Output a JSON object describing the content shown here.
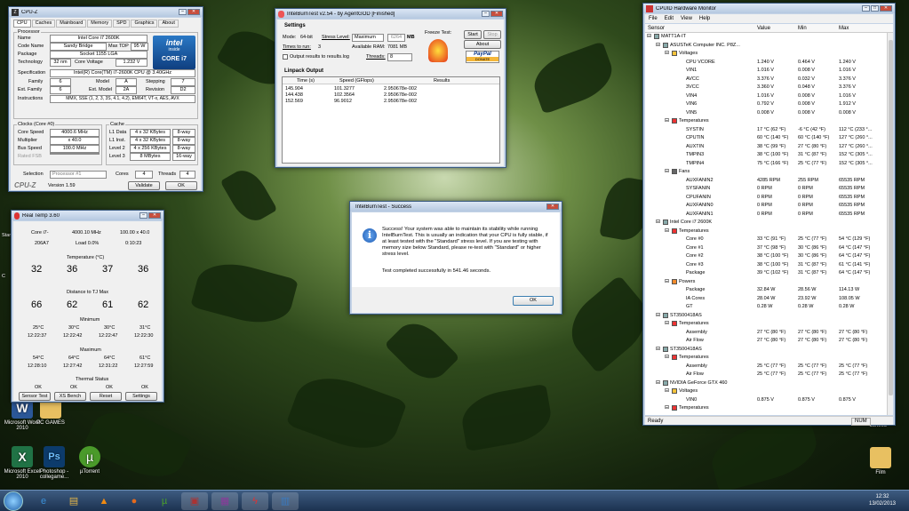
{
  "cpuz": {
    "title": "CPU-Z",
    "tabs": [
      "CPU",
      "Caches",
      "Mainboard",
      "Memory",
      "SPD",
      "Graphics",
      "About"
    ],
    "processor_group": "Processor",
    "name_label": "Name",
    "name": "Intel Core i7 2600K",
    "codename_label": "Code Name",
    "codename": "Sandy Bridge",
    "maxtdp_label": "Max TDP",
    "maxtdp": "95 W",
    "package_label": "Package",
    "package": "Socket 1155 LGA",
    "tech_label": "Technology",
    "tech": "32 nm",
    "voltage_label": "Core Voltage",
    "voltage": "1.232 V",
    "spec_label": "Specification",
    "spec": "Intel(R) Core(TM) i7-2600K CPU @ 3.40GHz",
    "family_label": "Family",
    "family": "6",
    "model_label": "Model",
    "model": "A",
    "stepping_label": "Stepping",
    "stepping": "7",
    "extfamily_label": "Ext. Family",
    "extfamily": "6",
    "extmodel_label": "Ext. Model",
    "extmodel": "2A",
    "revision_label": "Revision",
    "revision": "D2",
    "instr_label": "Instructions",
    "instr": "MMX, SSE (1, 2, 3, 3S, 4.1, 4.2), EM64T, VT-x, AES, AVX",
    "clocks_group": "Clocks (Core #0)",
    "corespeed_label": "Core Speed",
    "corespeed": "4000.6 MHz",
    "mult_label": "Multiplier",
    "mult": "x 40.0",
    "bus_label": "Bus Speed",
    "bus": "100.0 MHz",
    "fsb_label": "Rated FSB",
    "fsb": "",
    "cache_group": "Cache",
    "l1d_label": "L1 Data",
    "l1d": "4 x 32 KBytes",
    "l1d_way": "8-way",
    "l1i_label": "L1 Inst.",
    "l1i": "4 x 32 KBytes",
    "l1i_way": "8-way",
    "l2_label": "Level 2",
    "l2": "4 x 256 KBytes",
    "l2_way": "8-way",
    "l3_label": "Level 3",
    "l3": "8 MBytes",
    "l3_way": "16-way",
    "selection_label": "Selection",
    "selection": "Processor #1",
    "cores_label": "Cores",
    "cores": "4",
    "threads_label": "Threads",
    "threads": "4",
    "brand": "CPU-Z",
    "version": "Version 1.59",
    "validate": "Validate",
    "ok": "OK",
    "logo_top": "intel",
    "logo_mid": "inside",
    "logo_bottom": "CORE i7"
  },
  "realtemp": {
    "title": "Real Temp 3.60",
    "cpu": "Core i7-",
    "mhz": "4000.10 MHz",
    "mult": "100.00 x 40.0",
    "cpuid": "206A7",
    "load": "Load  0.0%",
    "uptime": "0:10:23",
    "temp_header": "Temperature (°C)",
    "temps": [
      "32",
      "36",
      "37",
      "36"
    ],
    "dist_header": "Distance to TJ Max",
    "dists": [
      "66",
      "62",
      "61",
      "62"
    ],
    "min_header": "Minimum",
    "mins": [
      "25°C",
      "30°C",
      "30°C",
      "31°C"
    ],
    "min_times": [
      "12:22:37",
      "12:22:42",
      "12:22:47",
      "12:22:30"
    ],
    "max_header": "Maximum",
    "maxs": [
      "54°C",
      "64°C",
      "64°C",
      "61°C"
    ],
    "max_times": [
      "12:28:10",
      "12:27:42",
      "12:31:22",
      "12:27:59"
    ],
    "thermal_header": "Thermal Status",
    "thermal": [
      "OK",
      "OK",
      "OK",
      "OK"
    ],
    "buttons": [
      "Sensor Test",
      "XS Bench",
      "Reset",
      "Settings"
    ]
  },
  "ibt": {
    "title": "IntelBurnTest v2.54 - by AgentGOD [Finished]",
    "settings": "Settings",
    "mode_label": "Mode:",
    "mode": "64-bit",
    "stress_label": "Stress Level:",
    "stress": "Maximum",
    "stress_mb": "6264",
    "mb": "MB",
    "times_label": "Times to run:",
    "times": "3",
    "ram_label": "Available RAM:",
    "ram": "7081 MB",
    "output_label": "Output results to results.log",
    "threads_label": "Threads:",
    "threads": "8",
    "freeze": "Freeze Test:",
    "start": "Start",
    "stop": "Stop",
    "about": "About",
    "paypal": "PayPal",
    "donate": "DONATE",
    "linpack": "Linpack Output",
    "cols": [
      "Time (s)",
      "Speed (GFlops)",
      "Results"
    ],
    "rows": [
      [
        "145.904",
        "101.3277",
        "2.950678e-002"
      ],
      [
        "144.438",
        "102.3564",
        "2.950678e-002"
      ],
      [
        "152.569",
        "96.9012",
        "2.950678e-002"
      ]
    ]
  },
  "dialog": {
    "title": "IntelBurnTest - Success",
    "msg": "Success! Your system was able to maintain its stability while running IntelBurnTest. This is usually an indication that your CPU is fully stable, if at least tested with the \"Standard\" stress level. If you are testing with memory size below Standard, please re-test with \"Standard\" or higher stress level.",
    "msg2": "Test completed successfully in 541.46 seconds.",
    "ok": "OK"
  },
  "hwmon": {
    "title": "CPUID Hardware Monitor",
    "menu": [
      "File",
      "Edit",
      "View",
      "Help"
    ],
    "cols": [
      "Sensor",
      "Value",
      "Min",
      "Max"
    ],
    "rows": [
      {
        "lvl": 0,
        "kind": "node",
        "name": "MATT1A-IT",
        "value": "",
        "min": "",
        "max": ""
      },
      {
        "lvl": 1,
        "kind": "node",
        "name": "ASUSTeK Computer INC. P8Z...",
        "value": "",
        "min": "",
        "max": ""
      },
      {
        "lvl": 2,
        "kind": "group",
        "name": "Voltages",
        "value": "",
        "min": "",
        "max": ""
      },
      {
        "lvl": 3,
        "kind": "item",
        "name": "CPU VCORE",
        "value": "1.240 V",
        "min": "0.464 V",
        "max": "1.240 V"
      },
      {
        "lvl": 3,
        "kind": "item",
        "name": "VIN1",
        "value": "1.016 V",
        "min": "0.008 V",
        "max": "1.016 V"
      },
      {
        "lvl": 3,
        "kind": "item",
        "name": "AVCC",
        "value": "3.376 V",
        "min": "0.032 V",
        "max": "3.376 V"
      },
      {
        "lvl": 3,
        "kind": "item",
        "name": "3VCC",
        "value": "3.360 V",
        "min": "0.048 V",
        "max": "3.376 V"
      },
      {
        "lvl": 3,
        "kind": "item",
        "name": "VIN4",
        "value": "1.016 V",
        "min": "0.008 V",
        "max": "1.016 V"
      },
      {
        "lvl": 3,
        "kind": "item",
        "name": "VIN6",
        "value": "0.792 V",
        "min": "0.008 V",
        "max": "1.912 V"
      },
      {
        "lvl": 3,
        "kind": "item",
        "name": "VIN5",
        "value": "0.008 V",
        "min": "0.008 V",
        "max": "0.008 V"
      },
      {
        "lvl": 2,
        "kind": "group",
        "name": "Temperatures",
        "value": "",
        "min": "",
        "max": ""
      },
      {
        "lvl": 3,
        "kind": "item",
        "name": "SYSTIN",
        "value": "17 °C (62 °F)",
        "min": "-6 °C (42 °F)",
        "max": "112 °C (233 °..."
      },
      {
        "lvl": 3,
        "kind": "item",
        "name": "CPUTIN",
        "value": "60 °C (140 °F)",
        "min": "60 °C (140 °F)",
        "max": "127 °C (260 °..."
      },
      {
        "lvl": 3,
        "kind": "item",
        "name": "AUXTIN",
        "value": "38 °C (99 °F)",
        "min": "27 °C (80 °F)",
        "max": "127 °C (260 °..."
      },
      {
        "lvl": 3,
        "kind": "item",
        "name": "TMPIN3",
        "value": "38 °C (100 °F)",
        "min": "31 °C (87 °F)",
        "max": "152 °C (305 °..."
      },
      {
        "lvl": 3,
        "kind": "item",
        "name": "TMPIN4",
        "value": "75 °C (166 °F)",
        "min": "25 °C (77 °F)",
        "max": "152 °C (305 °..."
      },
      {
        "lvl": 2,
        "kind": "group",
        "name": "Fans",
        "value": "",
        "min": "",
        "max": ""
      },
      {
        "lvl": 3,
        "kind": "item",
        "name": "AUXFANIN2",
        "value": "4285 RPM",
        "min": "255 RPM",
        "max": "65535 RPM"
      },
      {
        "lvl": 3,
        "kind": "item",
        "name": "SYSFANIN",
        "value": "0 RPM",
        "min": "0 RPM",
        "max": "65535 RPM"
      },
      {
        "lvl": 3,
        "kind": "item",
        "name": "CPUFANIN",
        "value": "0 RPM",
        "min": "0 RPM",
        "max": "65535 RPM"
      },
      {
        "lvl": 3,
        "kind": "item",
        "name": "AUXFANIN0",
        "value": "0 RPM",
        "min": "0 RPM",
        "max": "65535 RPM"
      },
      {
        "lvl": 3,
        "kind": "item",
        "name": "AUXFANIN1",
        "value": "0 RPM",
        "min": "0 RPM",
        "max": "65535 RPM"
      },
      {
        "lvl": 1,
        "kind": "node",
        "name": "Intel Core i7 2600K",
        "value": "",
        "min": "",
        "max": ""
      },
      {
        "lvl": 2,
        "kind": "group",
        "name": "Temperatures",
        "value": "",
        "min": "",
        "max": ""
      },
      {
        "lvl": 3,
        "kind": "item",
        "name": "Core #0",
        "value": "33 °C (91 °F)",
        "min": "25 °C (77 °F)",
        "max": "54 °C (129 °F)"
      },
      {
        "lvl": 3,
        "kind": "item",
        "name": "Core #1",
        "value": "37 °C (98 °F)",
        "min": "30 °C (86 °F)",
        "max": "64 °C (147 °F)"
      },
      {
        "lvl": 3,
        "kind": "item",
        "name": "Core #2",
        "value": "38 °C (100 °F)",
        "min": "30 °C (86 °F)",
        "max": "64 °C (147 °F)"
      },
      {
        "lvl": 3,
        "kind": "item",
        "name": "Core #3",
        "value": "38 °C (100 °F)",
        "min": "31 °C (87 °F)",
        "max": "61 °C (141 °F)"
      },
      {
        "lvl": 3,
        "kind": "item",
        "name": "Package",
        "value": "39 °C (102 °F)",
        "min": "31 °C (87 °F)",
        "max": "64 °C (147 °F)"
      },
      {
        "lvl": 2,
        "kind": "group",
        "name": "Powers",
        "value": "",
        "min": "",
        "max": ""
      },
      {
        "lvl": 3,
        "kind": "item",
        "name": "Package",
        "value": "32.84 W",
        "min": "28.56 W",
        "max": "114.13 W"
      },
      {
        "lvl": 3,
        "kind": "item",
        "name": "IA Cores",
        "value": "28.04 W",
        "min": "23.92 W",
        "max": "108.05 W"
      },
      {
        "lvl": 3,
        "kind": "item",
        "name": "GT",
        "value": "0.28 W",
        "min": "0.28 W",
        "max": "0.28 W"
      },
      {
        "lvl": 1,
        "kind": "node",
        "name": "ST3500418AS",
        "value": "",
        "min": "",
        "max": ""
      },
      {
        "lvl": 2,
        "kind": "group",
        "name": "Temperatures",
        "value": "",
        "min": "",
        "max": ""
      },
      {
        "lvl": 3,
        "kind": "item",
        "name": "Assembly",
        "value": "27 °C (80 °F)",
        "min": "27 °C (80 °F)",
        "max": "27 °C (80 °F)"
      },
      {
        "lvl": 3,
        "kind": "item",
        "name": "Air Flow",
        "value": "27 °C (80 °F)",
        "min": "27 °C (80 °F)",
        "max": "27 °C (80 °F)"
      },
      {
        "lvl": 1,
        "kind": "node",
        "name": "ST3500418AS",
        "value": "",
        "min": "",
        "max": ""
      },
      {
        "lvl": 2,
        "kind": "group",
        "name": "Temperatures",
        "value": "",
        "min": "",
        "max": ""
      },
      {
        "lvl": 3,
        "kind": "item",
        "name": "Assembly",
        "value": "25 °C (77 °F)",
        "min": "25 °C (77 °F)",
        "max": "25 °C (77 °F)"
      },
      {
        "lvl": 3,
        "kind": "item",
        "name": "Air Flow",
        "value": "25 °C (77 °F)",
        "min": "25 °C (77 °F)",
        "max": "25 °C (77 °F)"
      },
      {
        "lvl": 1,
        "kind": "node",
        "name": "NVIDIA GeForce GTX 460",
        "value": "",
        "min": "",
        "max": ""
      },
      {
        "lvl": 2,
        "kind": "group",
        "name": "Voltages",
        "value": "",
        "min": "",
        "max": ""
      },
      {
        "lvl": 3,
        "kind": "item",
        "name": "VIN0",
        "value": "0.875 V",
        "min": "0.875 V",
        "max": "0.875 V"
      },
      {
        "lvl": 2,
        "kind": "group",
        "name": "Temperatures",
        "value": "",
        "min": "",
        "max": ""
      }
    ],
    "status_ready": "Ready",
    "status_num": "NUM"
  },
  "desktop": {
    "icons": [
      {
        "label": "Microsoft Word 2010",
        "color": "#2b5797",
        "glyph": "W"
      },
      {
        "label": "PC GAMES",
        "color": "#e8c061",
        "glyph": "▮"
      },
      {
        "label": "Microsoft Excel 2010",
        "color": "#207245",
        "glyph": "X"
      },
      {
        "label": "Photoshop - collegame...",
        "color": "#0c3b6b",
        "glyph": "Ps"
      },
      {
        "label": "µTorrent",
        "color": "#4a9a2a",
        "glyph": "µ"
      },
      {
        "label": "cartella",
        "color": "",
        "glyph": ""
      },
      {
        "label": "Film",
        "color": "#e8c061",
        "glyph": "▮"
      }
    ],
    "edge_labels": [
      "Start",
      "C"
    ]
  },
  "taskbar": {
    "items": [
      {
        "name": "ie-icon",
        "glyph": "e",
        "color": "#3a8fd8"
      },
      {
        "name": "explorer-icon",
        "glyph": "▤",
        "color": "#e2b54a"
      },
      {
        "name": "vlc-icon",
        "glyph": "▲",
        "color": "#f08a12"
      },
      {
        "name": "firefox-icon",
        "glyph": "●",
        "color": "#e56a1d"
      },
      {
        "name": "utorrent-icon",
        "glyph": "µ",
        "color": "#4aa02a"
      },
      {
        "name": "cpuz-task-icon",
        "glyph": "▣",
        "color": "#a33"
      },
      {
        "name": "cpuid-task-icon",
        "glyph": "▦",
        "color": "#8a3a9a"
      },
      {
        "name": "ibt-task-icon",
        "glyph": "ϟ",
        "color": "#d33"
      },
      {
        "name": "realtemp-task-icon",
        "glyph": "▥",
        "color": "#3a7ac0"
      }
    ],
    "time": "12:32",
    "date": "13/02/2013"
  }
}
